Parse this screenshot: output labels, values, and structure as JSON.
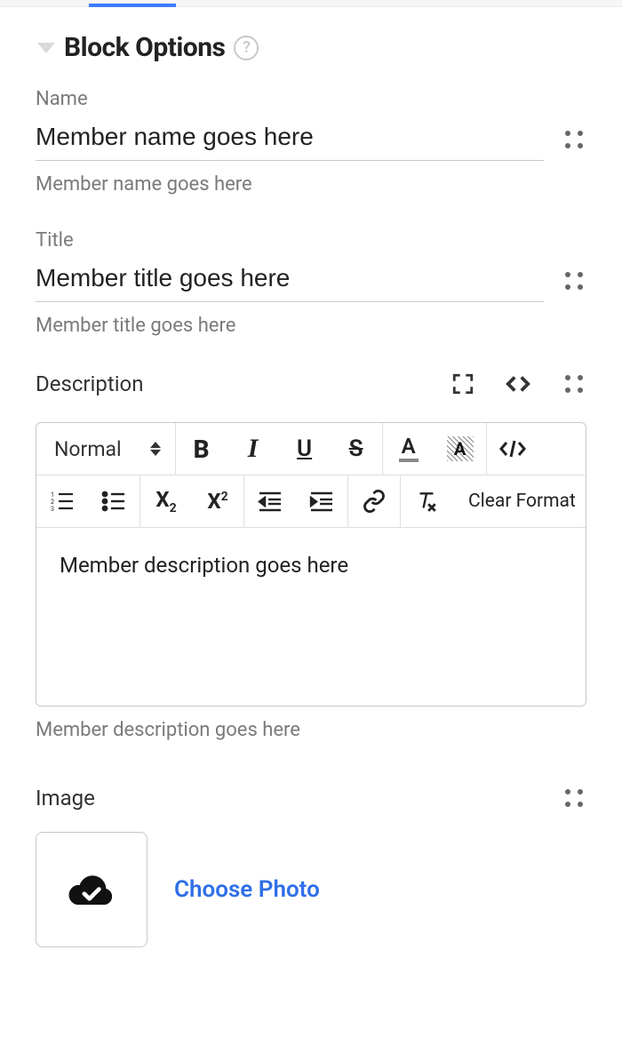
{
  "header": {
    "title": "Block Options"
  },
  "fields": {
    "name": {
      "label": "Name",
      "value": "Member name goes here",
      "helper": "Member name goes here"
    },
    "title": {
      "label": "Title",
      "value": "Member title goes here",
      "helper": "Member title goes here"
    },
    "description": {
      "label": "Description",
      "content": "Member description goes here",
      "helper": "Member description goes here"
    },
    "image": {
      "label": "Image",
      "choose": "Choose Photo"
    }
  },
  "toolbar": {
    "format": "Normal",
    "clear": "Clear Format"
  }
}
